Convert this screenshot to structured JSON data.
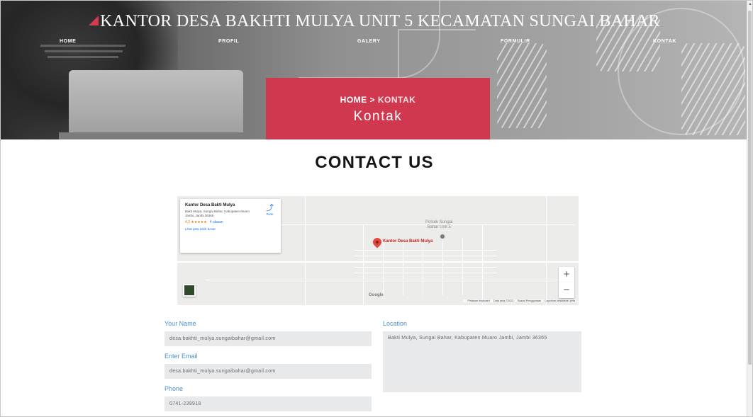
{
  "header": {
    "brand": "KANTOR DESA BAKHTI MULYA UNIT 5 KECAMATAN SUNGAI BAHAR",
    "nav": [
      "HOME",
      "PROFIL",
      "GALERY",
      "FORMULIR",
      "KONTAK"
    ],
    "breadcrumb": {
      "home": "HOME",
      "separator": ">",
      "current": "KONTAK"
    },
    "page_title": "Kontak",
    "accent_color": "#d0384f"
  },
  "main": {
    "heading": "CONTACT US",
    "map": {
      "place_name": "Kantor Desa Bakti Mulya",
      "address": "Bakti Mulya, Sungai Bahar, Kabupaten Muaro Jambi, Jambi 36365",
      "rating": "4,3 ★★★★★",
      "reviews": "4 ulasan",
      "larger_map_link": "Lihat peta lebih besar",
      "route_label": "Rute",
      "poi_label": [
        "Polsek Sungai",
        "Bahar Unit 5"
      ],
      "pin_label": "Kantor Desa Bakti Mulya",
      "zoom_in": "+",
      "zoom_out": "−",
      "google_logo": "Google",
      "attribution": [
        "Pintasan keyboard",
        "Data peta ©2021",
        "Syarat Penggunaan",
        "Laporkan kesalahan peta"
      ]
    },
    "form": {
      "name_label": "Your Name",
      "name_value": "desa.bakhti_mulya.sungaibahar@gmail.com",
      "email_label": "Enter Email",
      "email_value": "desa.bakhti_mulya.sungaibahar@gmail.com",
      "phone_label": "Phone",
      "phone_value": "0741-239918",
      "location_label": "Location",
      "location_value": "Bakti Mulya, Sungai Bahar, Kabupaten Muaro Jambi, Jambi 36365"
    }
  }
}
